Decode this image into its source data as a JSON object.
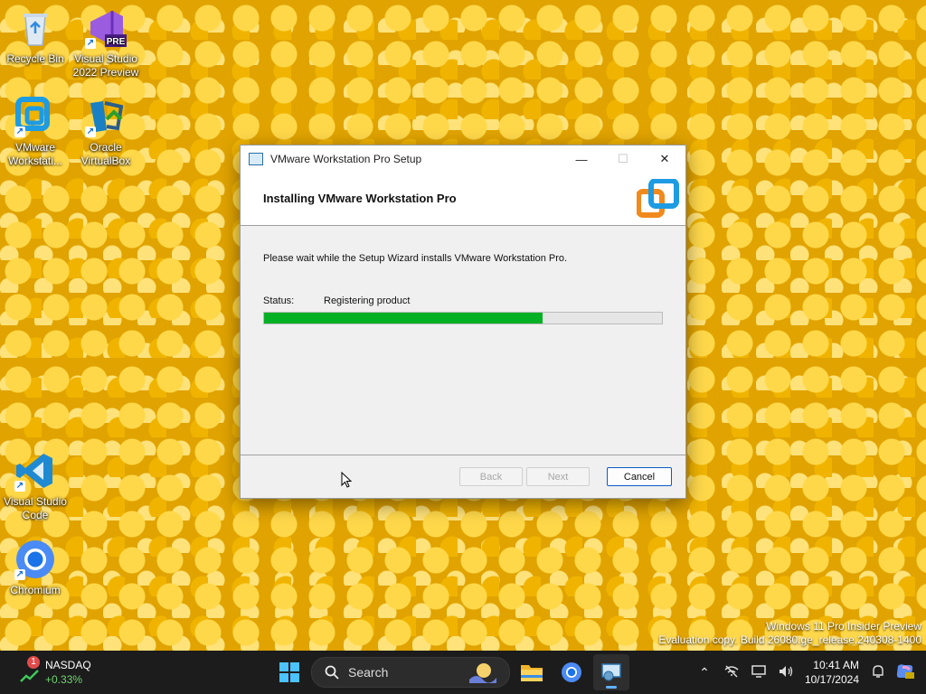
{
  "desktop": {
    "icons": [
      {
        "label": "Recycle Bin"
      },
      {
        "label": "Visual Studio 2022 Preview",
        "badge": "PRE"
      },
      {
        "label": "VMware Workstati..."
      },
      {
        "label": "Oracle VirtualBox"
      },
      {
        "label": "Visual Studio Code"
      },
      {
        "label": "Chromium"
      }
    ],
    "watermark": {
      "line1": "Windows 11 Pro Insider Preview",
      "line2": "Evaluation copy. Build 26080.ge_release.240308-1400"
    }
  },
  "dialog": {
    "title": "VMware Workstation Pro Setup",
    "window_controls": {
      "minimize": "—",
      "maximize": "☐",
      "close": "✕"
    },
    "heading": "Installing VMware Workstation Pro",
    "intro": "Please wait while the Setup Wizard installs VMware Workstation Pro.",
    "status_label": "Status:",
    "status_value": "Registering product",
    "progress_fraction": 0.7,
    "buttons": {
      "back": "Back",
      "next": "Next",
      "cancel": "Cancel"
    }
  },
  "taskbar": {
    "widget": {
      "badge": "1",
      "name": "NASDAQ",
      "change": "+0.33%"
    },
    "search_placeholder": "Search",
    "clock": {
      "time": "10:41 AM",
      "date": "10/17/2024"
    }
  },
  "colors": {
    "progress": "#06b025",
    "accent": "#0a5cc7"
  }
}
